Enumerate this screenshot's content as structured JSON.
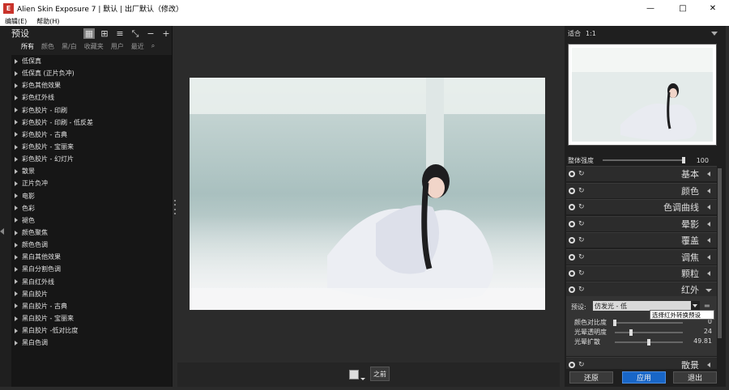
{
  "window": {
    "title": "Alien Skin Exposure 7 | 默认 | 出厂默认（修改）",
    "controls": {
      "minimize": "—",
      "maximize": "□",
      "close": "✕"
    }
  },
  "menu": {
    "items": [
      "编辑(E)",
      "帮助(H)"
    ]
  },
  "presets": {
    "title": "预设",
    "filters": [
      "所有",
      "颜色",
      "黑/白",
      "收藏夹",
      "用户",
      "最近"
    ],
    "items": [
      "低保真",
      "低保真 (正片负冲)",
      "彩色其他效果",
      "彩色红外线",
      "彩色胶片 - 印刷",
      "彩色胶片 - 印刷 - 低反差",
      "彩色胶片 - 古典",
      "彩色胶片 - 宝丽来",
      "彩色胶片 - 幻灯片",
      "散景",
      "正片负冲",
      "电影",
      "色彩",
      "褪色",
      "颜色聚焦",
      "颜色色调",
      "黑白其他效果",
      "黑白分割色调",
      "黑白红外线",
      "黑白胶片",
      "黑白胶片 - 古典",
      "黑白胶片 - 宝丽来",
      "黑白胶片 -低对比度",
      "黑白色调"
    ]
  },
  "center": {
    "before_label": "之前"
  },
  "navigator": {
    "fit_label": "适合",
    "zoom": "1:1"
  },
  "intensity": {
    "label": "整体强度",
    "value": "100",
    "level": 1.0
  },
  "sections": [
    "基本",
    "颜色",
    "色调曲线",
    "晕影",
    "覆盖",
    "调焦",
    "颗粒",
    "红外",
    "散景"
  ],
  "infrared": {
    "preset_label": "预设:",
    "preset_value": "仿发光 - 低",
    "tooltip": "选择红外转换预设",
    "sliders": [
      {
        "label": "颜色对比度",
        "value": "0",
        "level": 0.0
      },
      {
        "label": "光晕透明度",
        "value": "24",
        "level": 0.24
      },
      {
        "label": "光晕扩散",
        "value": "49.81",
        "level": 0.5
      }
    ]
  },
  "buttons": {
    "reset": "还原",
    "apply": "应用",
    "exit": "退出"
  }
}
